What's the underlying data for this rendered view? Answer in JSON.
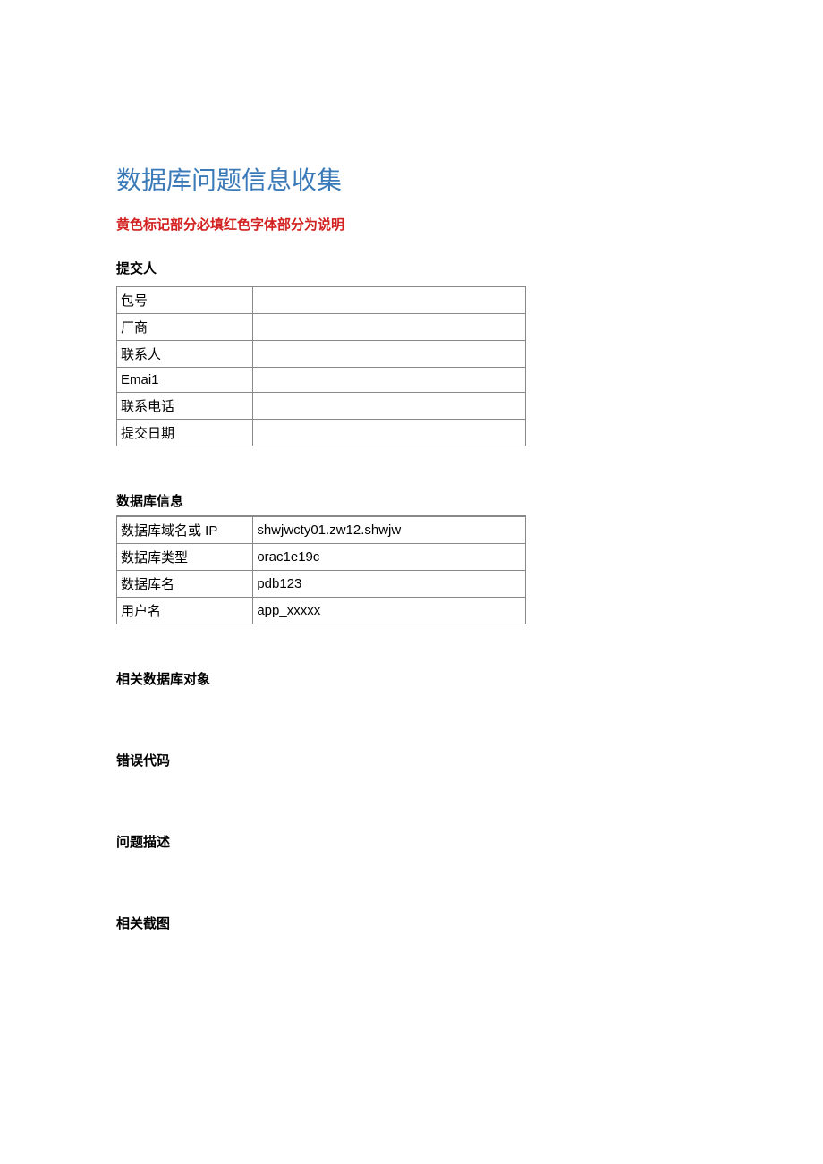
{
  "title": "数据库问题信息收集",
  "subtitle": "黄色标记部分必填红色字体部分为说明",
  "submitter": {
    "heading": "提交人",
    "rows": [
      {
        "label": "包号",
        "value": ""
      },
      {
        "label": "厂商",
        "value": ""
      },
      {
        "label": "联系人",
        "value": ""
      },
      {
        "label": "Emai1",
        "value": ""
      },
      {
        "label": "联系电话",
        "value": ""
      },
      {
        "label": "提交日期",
        "value": ""
      }
    ]
  },
  "dbinfo": {
    "heading": "数据库信息",
    "rows": [
      {
        "label": "数据库域名或 IP",
        "value": "shwjwcty01.zw12.shwjw"
      },
      {
        "label": "数据库类型",
        "value": "orac1e19c"
      },
      {
        "label": "数据库名",
        "value": "pdb123"
      },
      {
        "label": "用户名",
        "value": "app_xxxxx"
      }
    ]
  },
  "sections": {
    "related_objects": "相关数据库对象",
    "error_code": "错误代码",
    "problem_desc": "问题描述",
    "screenshot": "相关截图"
  }
}
